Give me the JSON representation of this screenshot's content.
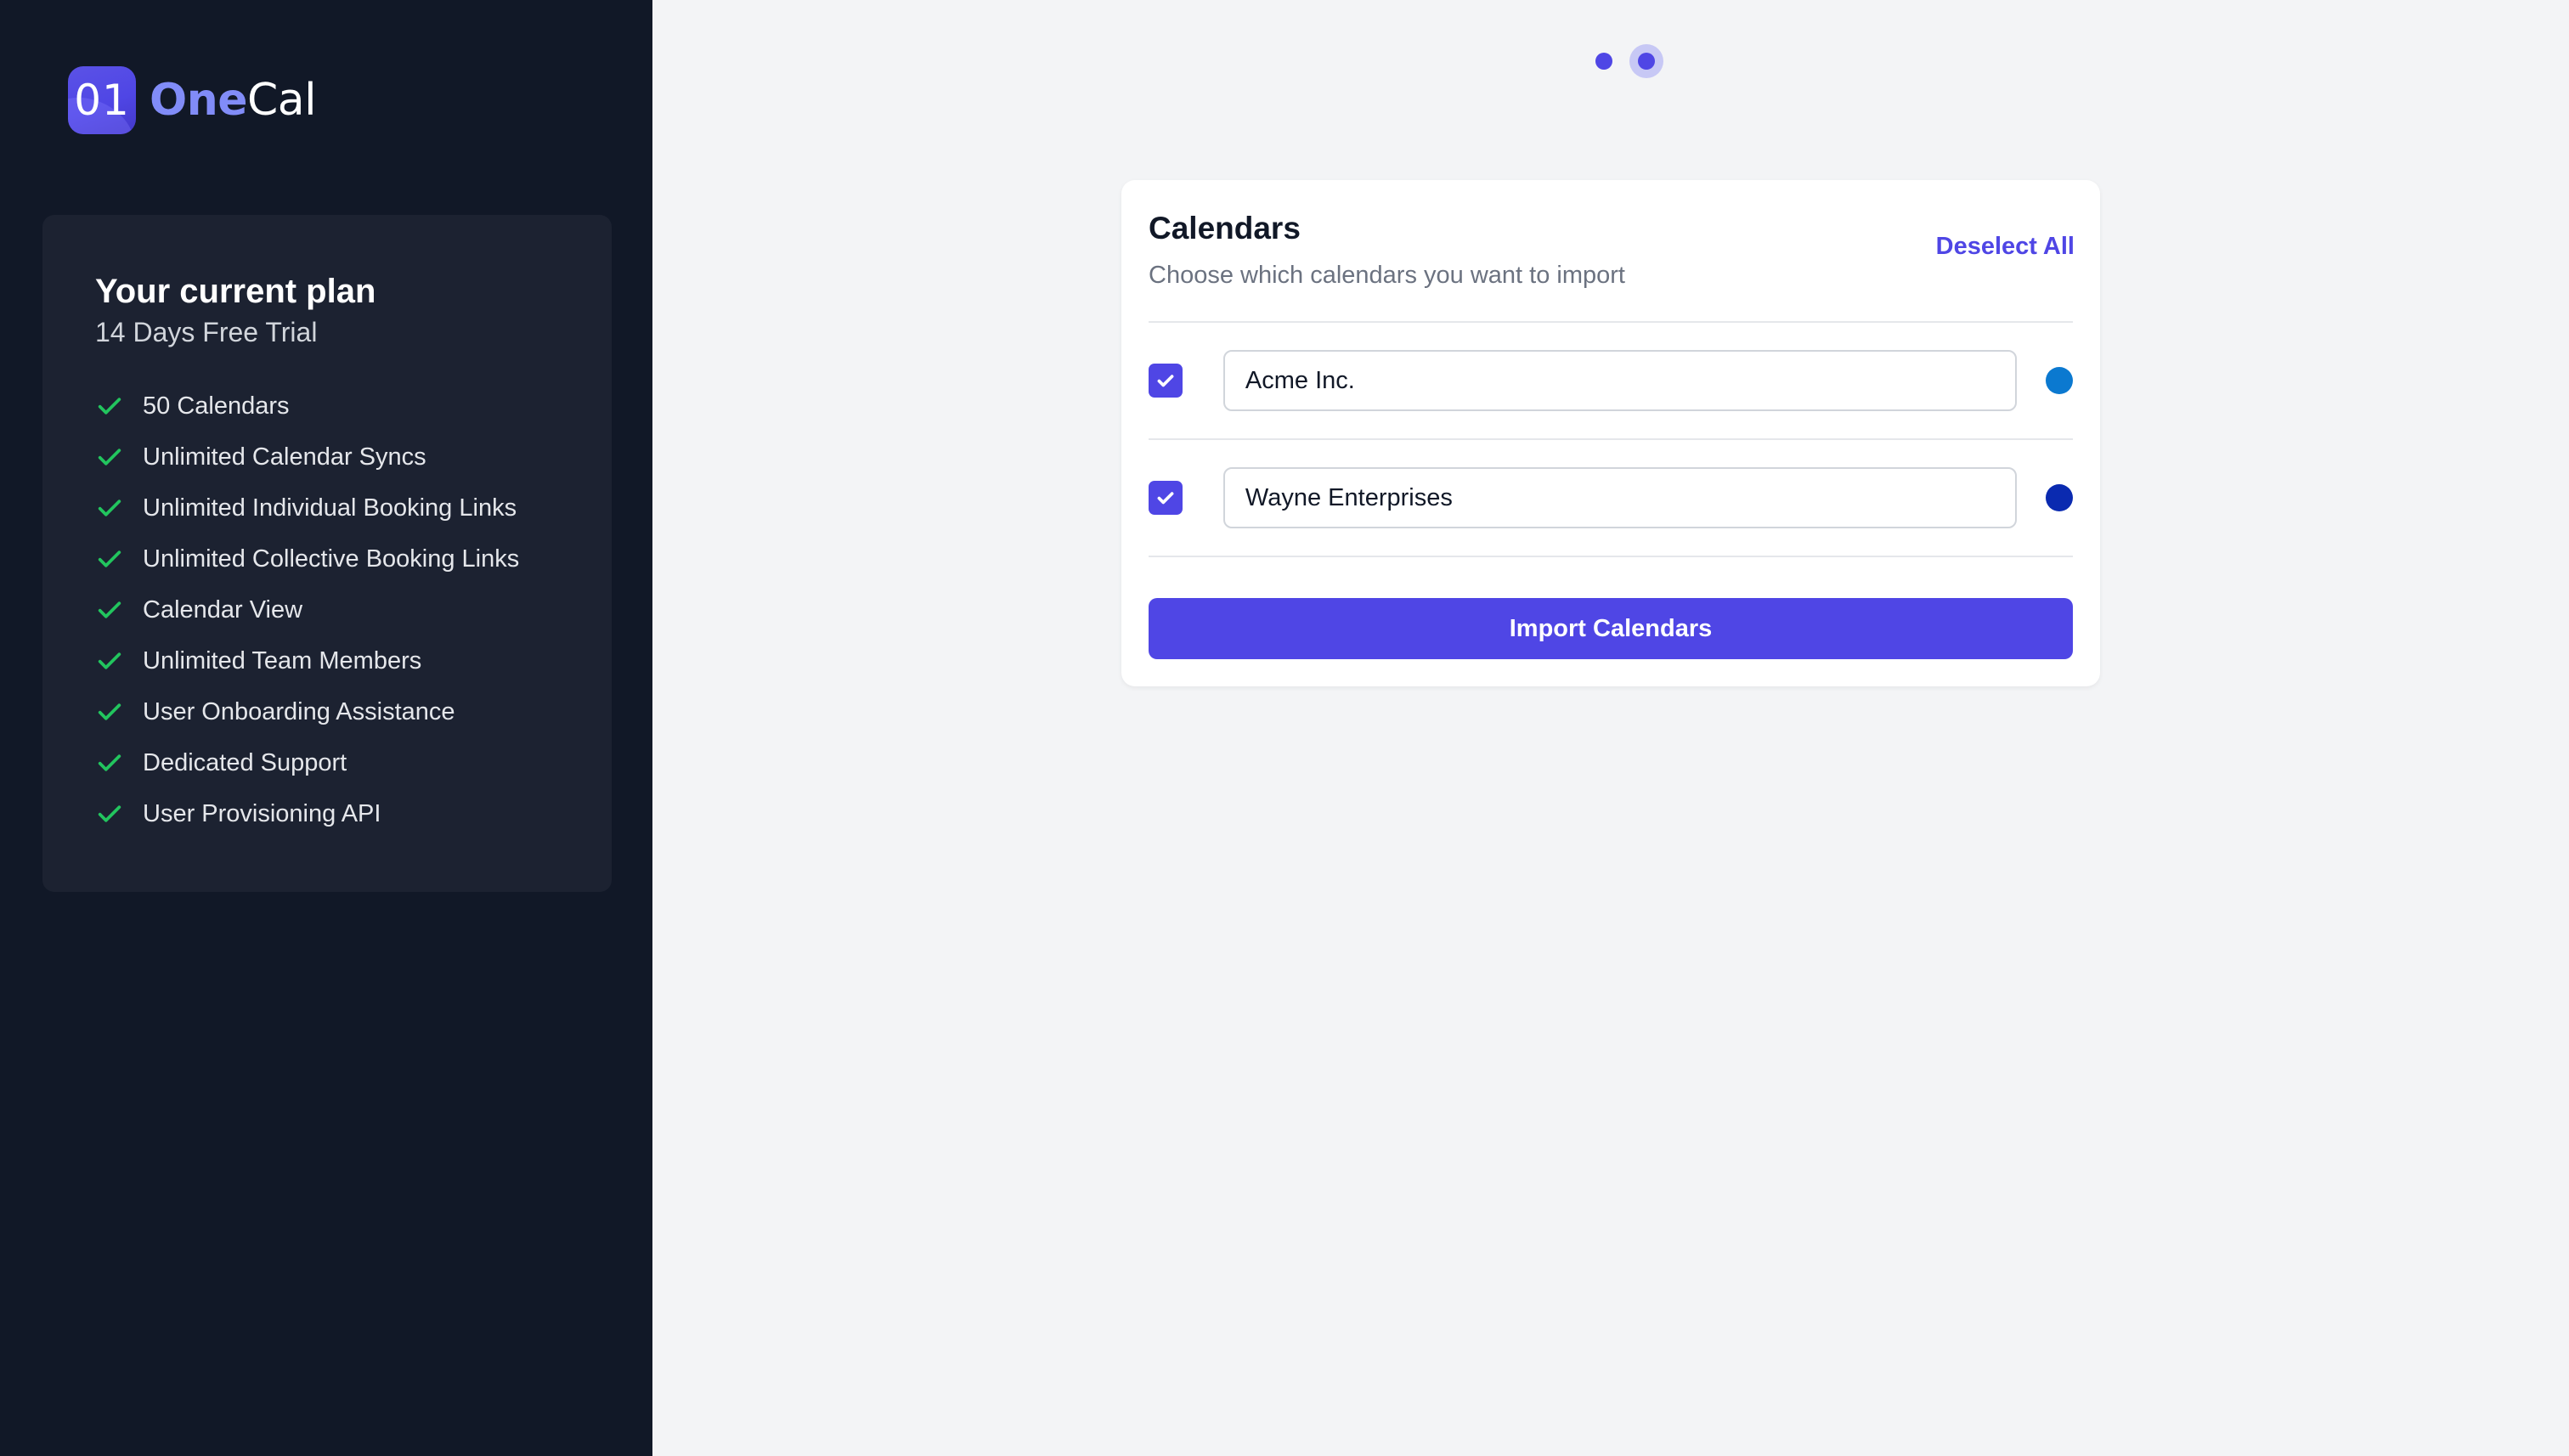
{
  "brand": {
    "logo_glyph": "01",
    "name_part1": "One",
    "name_part2": "Cal"
  },
  "plan": {
    "title": "Your current plan",
    "subtitle": "14 Days Free Trial",
    "features": [
      {
        "label": "50 Calendars",
        "icon": "check-icon"
      },
      {
        "label": "Unlimited Calendar Syncs",
        "icon": "check-icon"
      },
      {
        "label": "Unlimited Individual Booking Links",
        "icon": "check-icon"
      },
      {
        "label": "Unlimited Collective Booking Links",
        "icon": "check-icon"
      },
      {
        "label": "Calendar View",
        "icon": "check-icon"
      },
      {
        "label": "Unlimited Team Members",
        "icon": "check-icon"
      },
      {
        "label": "User Onboarding Assistance",
        "icon": "check-icon"
      },
      {
        "label": "Dedicated Support",
        "icon": "check-icon"
      },
      {
        "label": "User Provisioning API",
        "icon": "check-icon"
      }
    ]
  },
  "stepper": {
    "total_steps": 2,
    "current_step": 2
  },
  "calendars_card": {
    "title": "Calendars",
    "subtitle": "Choose which calendars you want to import",
    "deselect_label": "Deselect All",
    "items": [
      {
        "name": "Acme Inc.",
        "checked": true,
        "color": "#0b79d0"
      },
      {
        "name": "Wayne Enterprises",
        "checked": true,
        "color": "#0a2ab0"
      }
    ],
    "import_label": "Import Calendars"
  },
  "colors": {
    "accent": "#4f46e5",
    "sidebar_bg": "#111827",
    "check_green": "#22c55e"
  }
}
